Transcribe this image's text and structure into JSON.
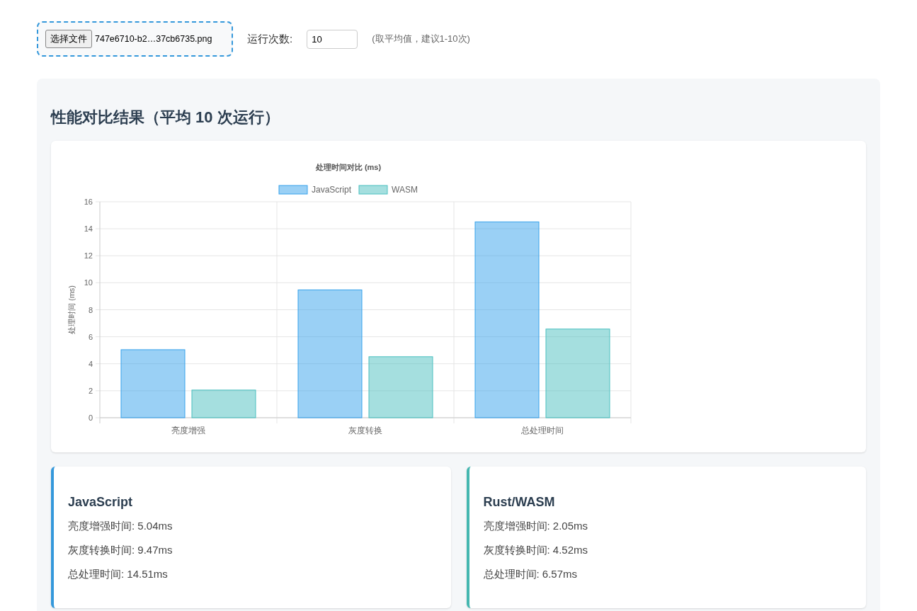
{
  "controls": {
    "file_button": "选择文件",
    "file_name": "747e6710-b2…37cb6735.png",
    "runs_label": "运行次数:",
    "runs_value": "10",
    "runs_hint": "(取平均值，建议1-10次)"
  },
  "results": {
    "title": "性能对比结果（平均 10 次运行）",
    "chart_data": {
      "type": "bar",
      "title": "处理时间对比 (ms)",
      "ylabel": "处理时间 (ms)",
      "categories": [
        "亮度增强",
        "灰度转换",
        "总处理时间"
      ],
      "ylim": [
        0,
        16
      ],
      "grid": true,
      "legend": "top",
      "yticks": [
        0,
        2,
        4,
        6,
        8,
        10,
        12,
        14,
        16
      ],
      "series": [
        {
          "name": "JavaScript",
          "color": "#36a2eb",
          "values": [
            5.04,
            9.47,
            14.51
          ]
        },
        {
          "name": "WASM",
          "color": "#4bc0c0",
          "values": [
            2.05,
            4.52,
            6.57
          ]
        }
      ]
    },
    "cards": [
      {
        "title": "JavaScript",
        "color": "#3498db",
        "lines": [
          "亮度增强时间: 5.04ms",
          "灰度转换时间: 9.47ms",
          "总处理时间: 14.51ms"
        ]
      },
      {
        "title": "Rust/WASM",
        "color": "#45b7b0",
        "lines": [
          "亮度增强时间: 2.05ms",
          "灰度转换时间: 4.52ms",
          "总处理时间: 6.57ms"
        ]
      }
    ]
  }
}
